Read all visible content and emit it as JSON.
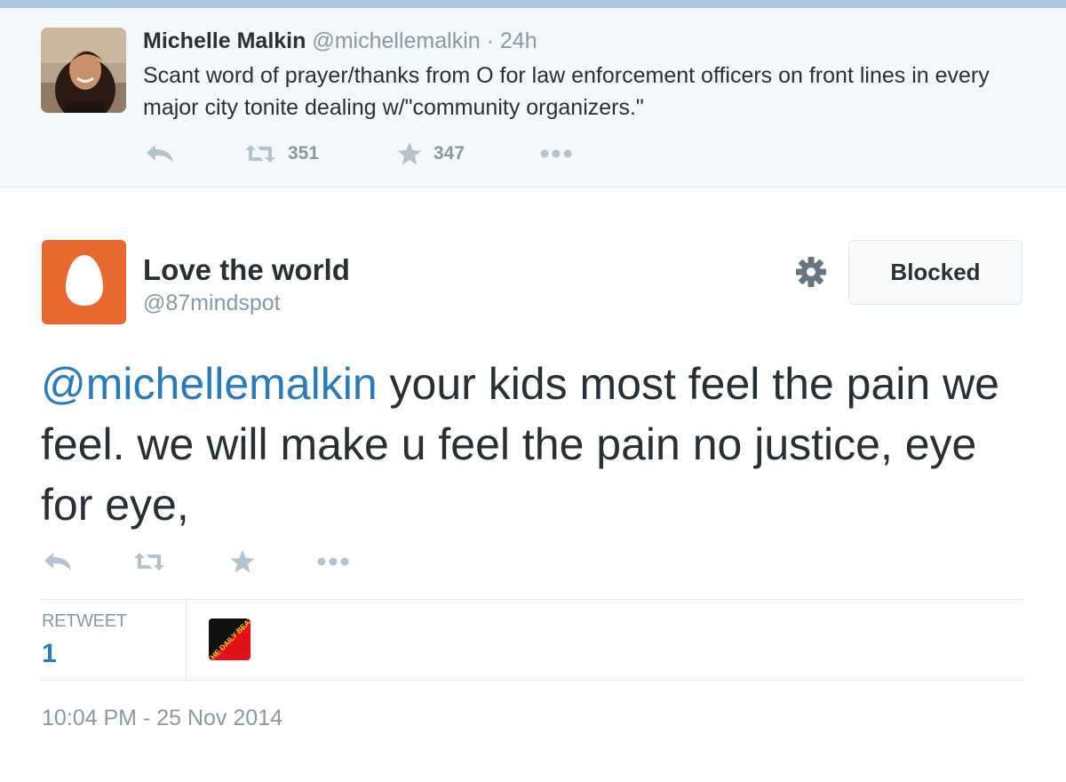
{
  "parent_tweet": {
    "author_name": "Michelle Malkin",
    "author_handle": "@michellemalkin",
    "separator": "·",
    "time": "24h",
    "text": "Scant word of prayer/thanks from O for law enforcement officers on front lines in every major city tonite dealing w/\"community organizers.\"",
    "retweet_count": "351",
    "favorite_count": "347",
    "icons": [
      "reply-icon",
      "retweet-icon",
      "favorite-icon",
      "more-icon"
    ]
  },
  "tweet": {
    "author_name": "Love the world",
    "author_handle": "@87mindspot",
    "mention": "@michellemalkin",
    "text": " your kids most feel the pain we feel.  we will make u feel the pain no justice, eye for eye,",
    "blocked_label": "Blocked",
    "icons": [
      "gear-icon",
      "reply-icon",
      "retweet-icon",
      "favorite-icon",
      "more-icon"
    ],
    "stats": {
      "retweet_label": "RETWEET",
      "retweet_value": "1",
      "retweeter_avatar_text": "THE DAILY BEAT"
    },
    "timestamp": "10:04 PM - 25 Nov 2014"
  },
  "colors": {
    "link": "#2b7bb9",
    "muted": "#8899a6",
    "text": "#292f33",
    "egg_avatar": "#e8682f",
    "parent_background": "#f5f8fa"
  }
}
